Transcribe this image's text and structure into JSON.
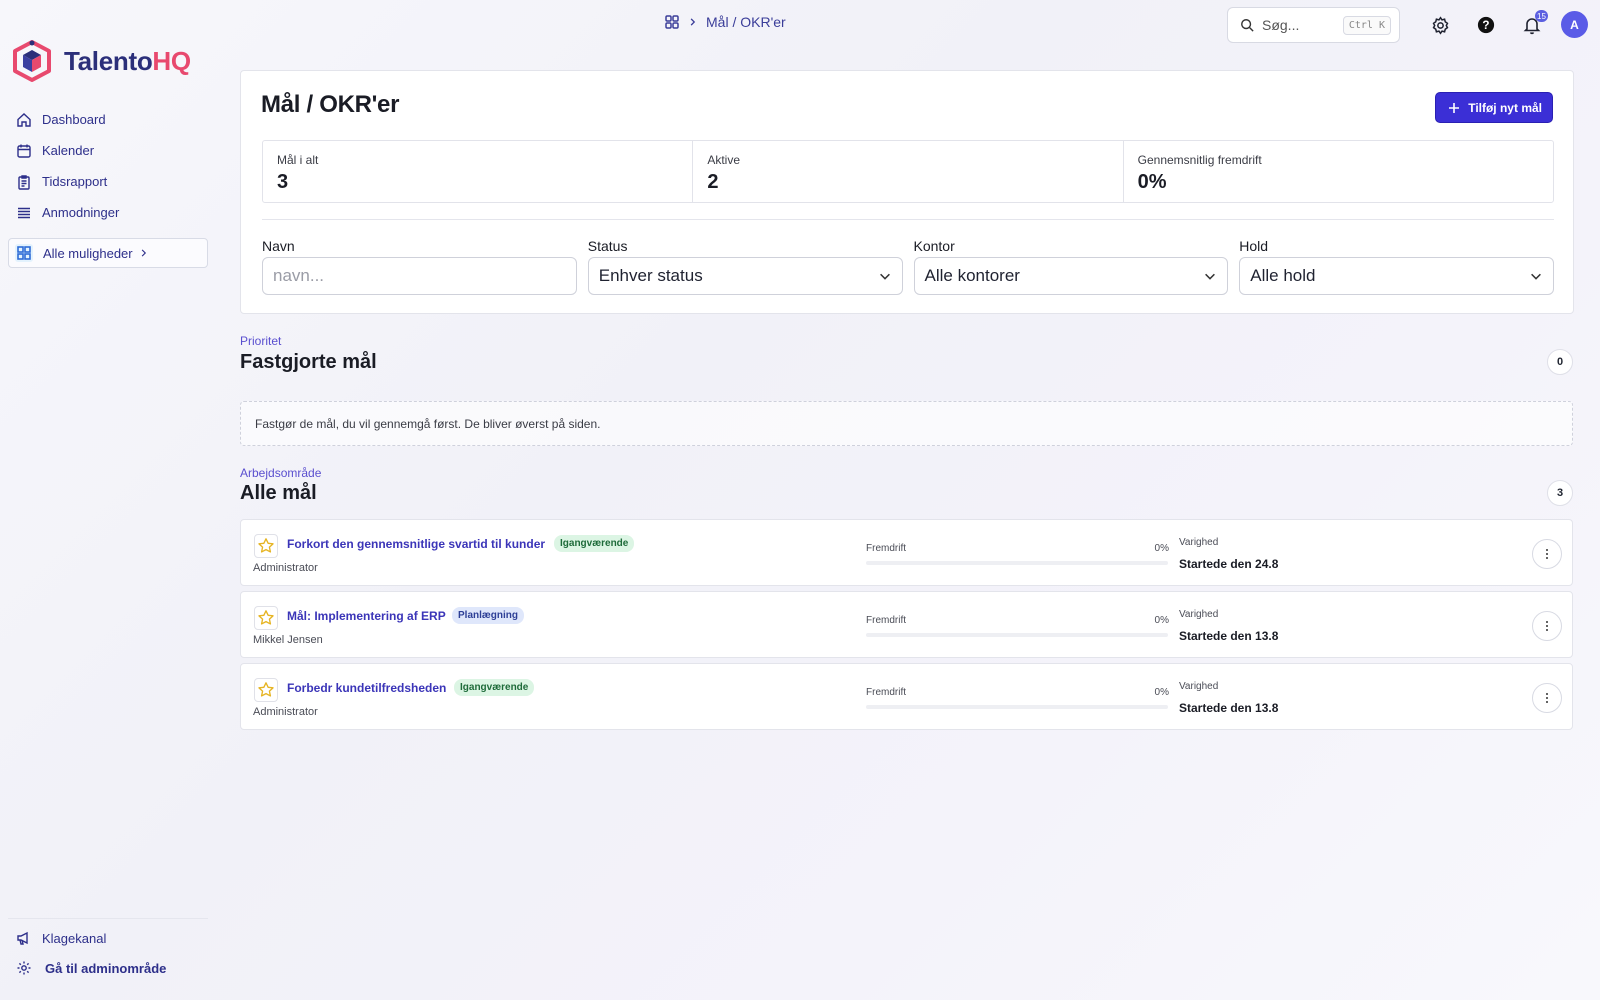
{
  "brand": {
    "name_part1": "Talento",
    "name_part2": "HQ",
    "color_primary": "#2b2f7a",
    "color_accent": "#e8496e"
  },
  "sidebar": {
    "items": [
      {
        "label": "Dashboard",
        "icon": "home-icon"
      },
      {
        "label": "Kalender",
        "icon": "calendar-icon"
      },
      {
        "label": "Tidsrapport",
        "icon": "clipboard-icon"
      },
      {
        "label": "Anmodninger",
        "icon": "list-icon"
      }
    ],
    "all_options": "Alle muligheder",
    "bottom": [
      {
        "label": "Klagekanal",
        "icon": "megaphone-icon"
      },
      {
        "label": "Gå til adminområde",
        "icon": "gear-icon"
      }
    ]
  },
  "topbar": {
    "breadcrumb": "Mål / OKR'er",
    "search_placeholder": "Søg...",
    "search_shortcut": "Ctrl K",
    "notification_count": "15",
    "avatar_initial": "A"
  },
  "page": {
    "title": "Mål / OKR'er",
    "add_button": "Tilføj nyt mål",
    "accent": "#3b2fd6"
  },
  "stats": [
    {
      "label": "Mål i alt",
      "value": "3"
    },
    {
      "label": "Aktive",
      "value": "2"
    },
    {
      "label": "Gennemsnitlig fremdrift",
      "value": "0%"
    }
  ],
  "filters": {
    "name": {
      "label": "Navn",
      "placeholder": "navn..."
    },
    "status": {
      "label": "Status",
      "value": "Enhver status"
    },
    "office": {
      "label": "Kontor",
      "value": "Alle kontorer"
    },
    "team": {
      "label": "Hold",
      "value": "Alle hold"
    }
  },
  "pinned": {
    "kicker": "Prioritet",
    "title": "Fastgjorte mål",
    "count": "0",
    "empty_text": "Fastgør de mål, du vil gennemgå først. De bliver øverst på siden."
  },
  "all_goals": {
    "kicker": "Arbejdsområde",
    "title": "Alle mål",
    "count": "3",
    "progress_label": "Fremdrift",
    "duration_label": "Varighed",
    "goals": [
      {
        "title": "Forkort den gennemsnitlige svartid til kunder",
        "status": "Igangværende",
        "status_color": "green",
        "owner": "Administrator",
        "progress_text": "0%",
        "progress": 0,
        "duration": "Startede den 24.8"
      },
      {
        "title": "Mål: Implementering af ERP",
        "status": "Planlægning",
        "status_color": "blue",
        "owner": "Mikkel Jensen",
        "progress_text": "0%",
        "progress": 0,
        "duration": "Startede den 13.8"
      },
      {
        "title": "Forbedr kundetilfredsheden",
        "status": "Igangværende",
        "status_color": "green",
        "owner": "Administrator",
        "progress_text": "0%",
        "progress": 0,
        "duration": "Startede den 13.8"
      }
    ]
  }
}
